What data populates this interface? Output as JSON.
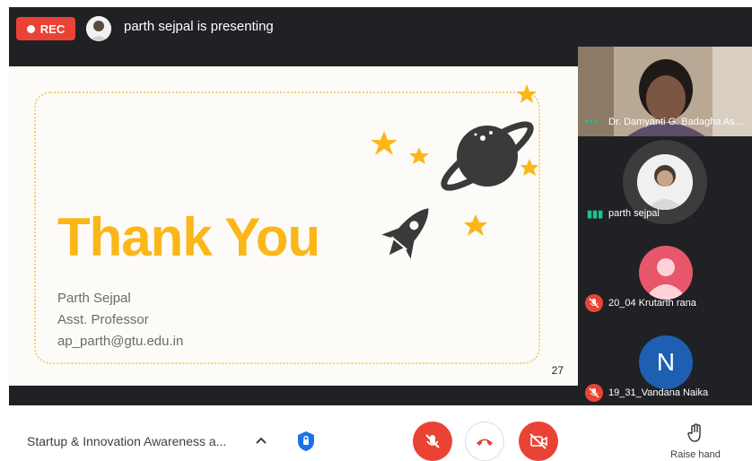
{
  "topbar": {
    "rec_label": "REC",
    "presenting_text": "parth sejpal is presenting"
  },
  "slide": {
    "title": "Thank You",
    "name": "Parth Sejpal",
    "role": "Asst. Professor",
    "email": "ap_parth@gtu.edu.in",
    "page_number": "27"
  },
  "participants": [
    {
      "name": "Dr. Damyanti G. Badagha As...",
      "status": "speaking"
    },
    {
      "name": "parth sejpal",
      "status": "presenting"
    },
    {
      "name": "20_04 Krutarth rana",
      "status": "muted"
    },
    {
      "name": "19_31_Vandana Naika",
      "status": "muted",
      "initial": "N"
    }
  ],
  "bottombar": {
    "meeting_title": "Startup & Innovation Awareness a...",
    "raise_hand_label": "Raise hand"
  },
  "colors": {
    "accent_red": "#ea4335",
    "slide_yellow": "#fbb618",
    "dark_bg": "#202124",
    "avatar_blue": "#1e5fb1",
    "avatar_pink": "#e8566b"
  }
}
